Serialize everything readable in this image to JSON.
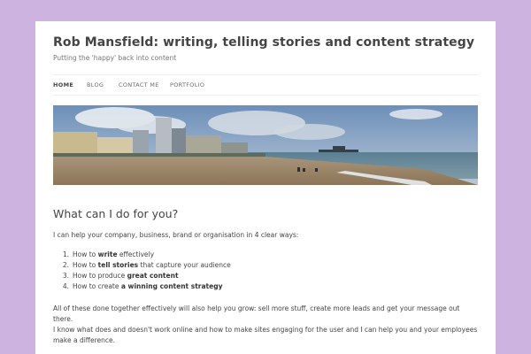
{
  "site": {
    "title": "Rob Mansfield: writing, telling stories and content strategy",
    "description": "Putting the 'happy' back into content"
  },
  "nav": {
    "items": [
      {
        "label": "HOME"
      },
      {
        "label": "BLOG"
      },
      {
        "label": "CONTACT ME"
      },
      {
        "label": "PORTFOLIO"
      }
    ]
  },
  "colors": {
    "background": "#cdb3e0",
    "page": "#ffffff",
    "text": "#444444"
  },
  "content": {
    "heading": "What can I do for you?",
    "intro": "I can help your company, business, brand or organisation in 4 clear ways:",
    "list": [
      {
        "num": "1.",
        "pre": "How to ",
        "bold": "write",
        "post": " effectively"
      },
      {
        "num": "2.",
        "pre": "How to ",
        "bold": "tell stories",
        "post": " that capture your audience"
      },
      {
        "num": "3.",
        "pre": "How to produce ",
        "bold": "great content",
        "post": ""
      },
      {
        "num": "4.",
        "pre": "How to create ",
        "bold": "a winning content strategy",
        "post": ""
      }
    ],
    "para2": "All of these done together effectively will also help you grow: sell more stuff, create more leads and get your message out there.",
    "para3": "I know what does and doesn't work online and how to make sites engaging for the user and I can help you and your employees make a difference."
  }
}
